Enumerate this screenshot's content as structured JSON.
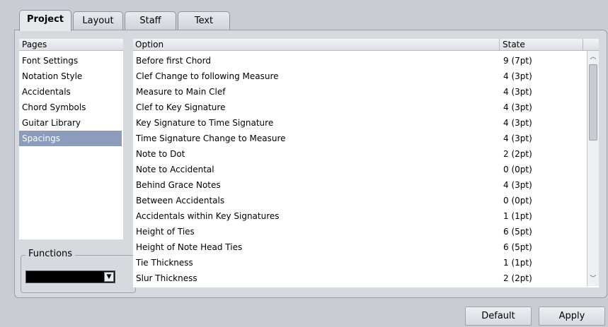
{
  "tabs": [
    {
      "label": "Project",
      "active": true
    },
    {
      "label": "Layout",
      "active": false
    },
    {
      "label": "Staff",
      "active": false
    },
    {
      "label": "Text",
      "active": false
    }
  ],
  "pages": {
    "header": "Pages",
    "items": [
      "Font Settings",
      "Notation Style",
      "Accidentals",
      "Chord Symbols",
      "Guitar Library",
      "Spacings"
    ],
    "selected": "Spacings"
  },
  "table": {
    "headers": {
      "option": "Option",
      "state": "State"
    },
    "rows": [
      {
        "option": "Before first Chord",
        "state": "9 (7pt)"
      },
      {
        "option": "Clef Change to following Measure",
        "state": "4 (3pt)"
      },
      {
        "option": "Measure to Main Clef",
        "state": "4 (3pt)"
      },
      {
        "option": "Clef to Key Signature",
        "state": "4 (3pt)"
      },
      {
        "option": "Key Signature to Time Signature",
        "state": "4 (3pt)"
      },
      {
        "option": "Time Signature Change to Measure",
        "state": "4 (3pt)"
      },
      {
        "option": "Note to Dot",
        "state": "2 (2pt)"
      },
      {
        "option": "Note to Accidental",
        "state": "0 (0pt)"
      },
      {
        "option": "Behind Grace Notes",
        "state": "4 (3pt)"
      },
      {
        "option": "Between Accidentals",
        "state": "0 (0pt)"
      },
      {
        "option": "Accidentals within Key Signatures",
        "state": "1 (1pt)"
      },
      {
        "option": "Height of Ties",
        "state": "6 (5pt)"
      },
      {
        "option": "Height of Note Head Ties",
        "state": "6 (5pt)"
      },
      {
        "option": "Tie Thickness",
        "state": "1 (1pt)"
      },
      {
        "option": "Slur Thickness",
        "state": "2 (2pt)"
      }
    ]
  },
  "functions": {
    "legend": "Functions",
    "value": ""
  },
  "buttons": {
    "default": "Default",
    "apply": "Apply"
  },
  "icons": {
    "scroll_up": "chevron-up-icon",
    "scroll_down": "chevron-down-icon",
    "dropdown": "chevron-down-icon"
  },
  "colors": {
    "selection": "#8b9cbc",
    "panel": "#d6d9de",
    "background": "#c9ccd2"
  }
}
